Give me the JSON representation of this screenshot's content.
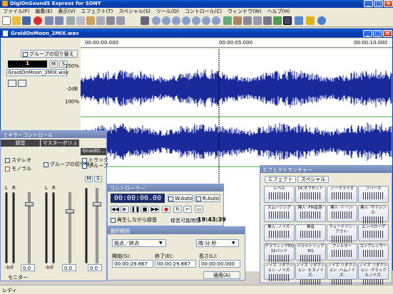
{
  "app": {
    "title": "DigiOnSound5 Express for SONY",
    "icon": "app-logo-icon"
  },
  "menu": [
    "ファイル(F)",
    "編集(E)",
    "表示(V)",
    "エフェクト(T)",
    "スペシャル(S)",
    "ツール(O)",
    "コントロール(C)",
    "ウィンドウ(W)",
    "ヘルプ(H)"
  ],
  "doc": {
    "title": "GraidOnMoon_2MIX.wav",
    "group_toggle": "グループの切り替え",
    "track_number": "1",
    "btn_m": "M",
    "btn_s": "S",
    "track_name": "GraidOnMoon_2MIX.wav",
    "time_start": "00:00:00.000",
    "time_mid": "00:00:05.000",
    "time_end": "00:00:10.000",
    "db_top": "150%",
    "db_mid": "-2dB",
    "db_bot": "100%"
  },
  "mixer": {
    "title": "ミキサーコントロール",
    "col_rec": "録音",
    "col_master": "マスターボリューム",
    "col_track": "GraidO...",
    "stereo": "ステレオ",
    "mono": "モノラル",
    "group_toggle": "グループの切り替え",
    "chk_track": "トラック",
    "chk_group": "グループ",
    "btn_m": "M",
    "btn_s": "S",
    "left": "L",
    "right": "R",
    "monitor": "モニター",
    "inf": "-Inf",
    "val1": "0.0",
    "val2": "0.0",
    "val3": "0.0"
  },
  "controller": {
    "title": "コントローラー",
    "time": "00:00:00.00",
    "w_auto": "W.Auto",
    "r_auto": "R.Auto",
    "play_while_rec": "再生しながら録音",
    "rec_time_label": "録音可能時間",
    "rec_time": "19:43:39"
  },
  "selection": {
    "title": "選択範囲",
    "mode": "始点／終点",
    "unit": "時:分:秒",
    "start_label": "開始(S):",
    "end_label": "終了(E):",
    "length_label": "長さ(L):",
    "start": "00:00:29.867",
    "end": "00:00:29.867",
    "length": "00:00:00.000",
    "apply": "適用(A)"
  },
  "effects": {
    "title": "エフェクトランチャー",
    "tab1": "エフェクト",
    "tab2": "スペシャル",
    "items": [
      "レベル",
      "DCオフセット",
      "ノーマライズ",
      "リバース",
      "スムージング",
      "挿入 -FM音源-",
      "挿入 -トーン-",
      "挿入 -サイレンス-",
      "挿入 -ノイズ-",
      "無音",
      "フェードイン -アウト-",
      "エンベロープ",
      "グラフィックEQ 10バンド",
      "パラメトリック EQ",
      "フィルター",
      "コンプレッサー",
      "ノイズ リダクション -ノイズ-",
      "ノイズ リダクション -ヒスノイズ-",
      "ノイズ リダクション -ハムノイズ-",
      "ノイズ リダクション -クラックルノイズ-"
    ]
  },
  "status": "レディ"
}
